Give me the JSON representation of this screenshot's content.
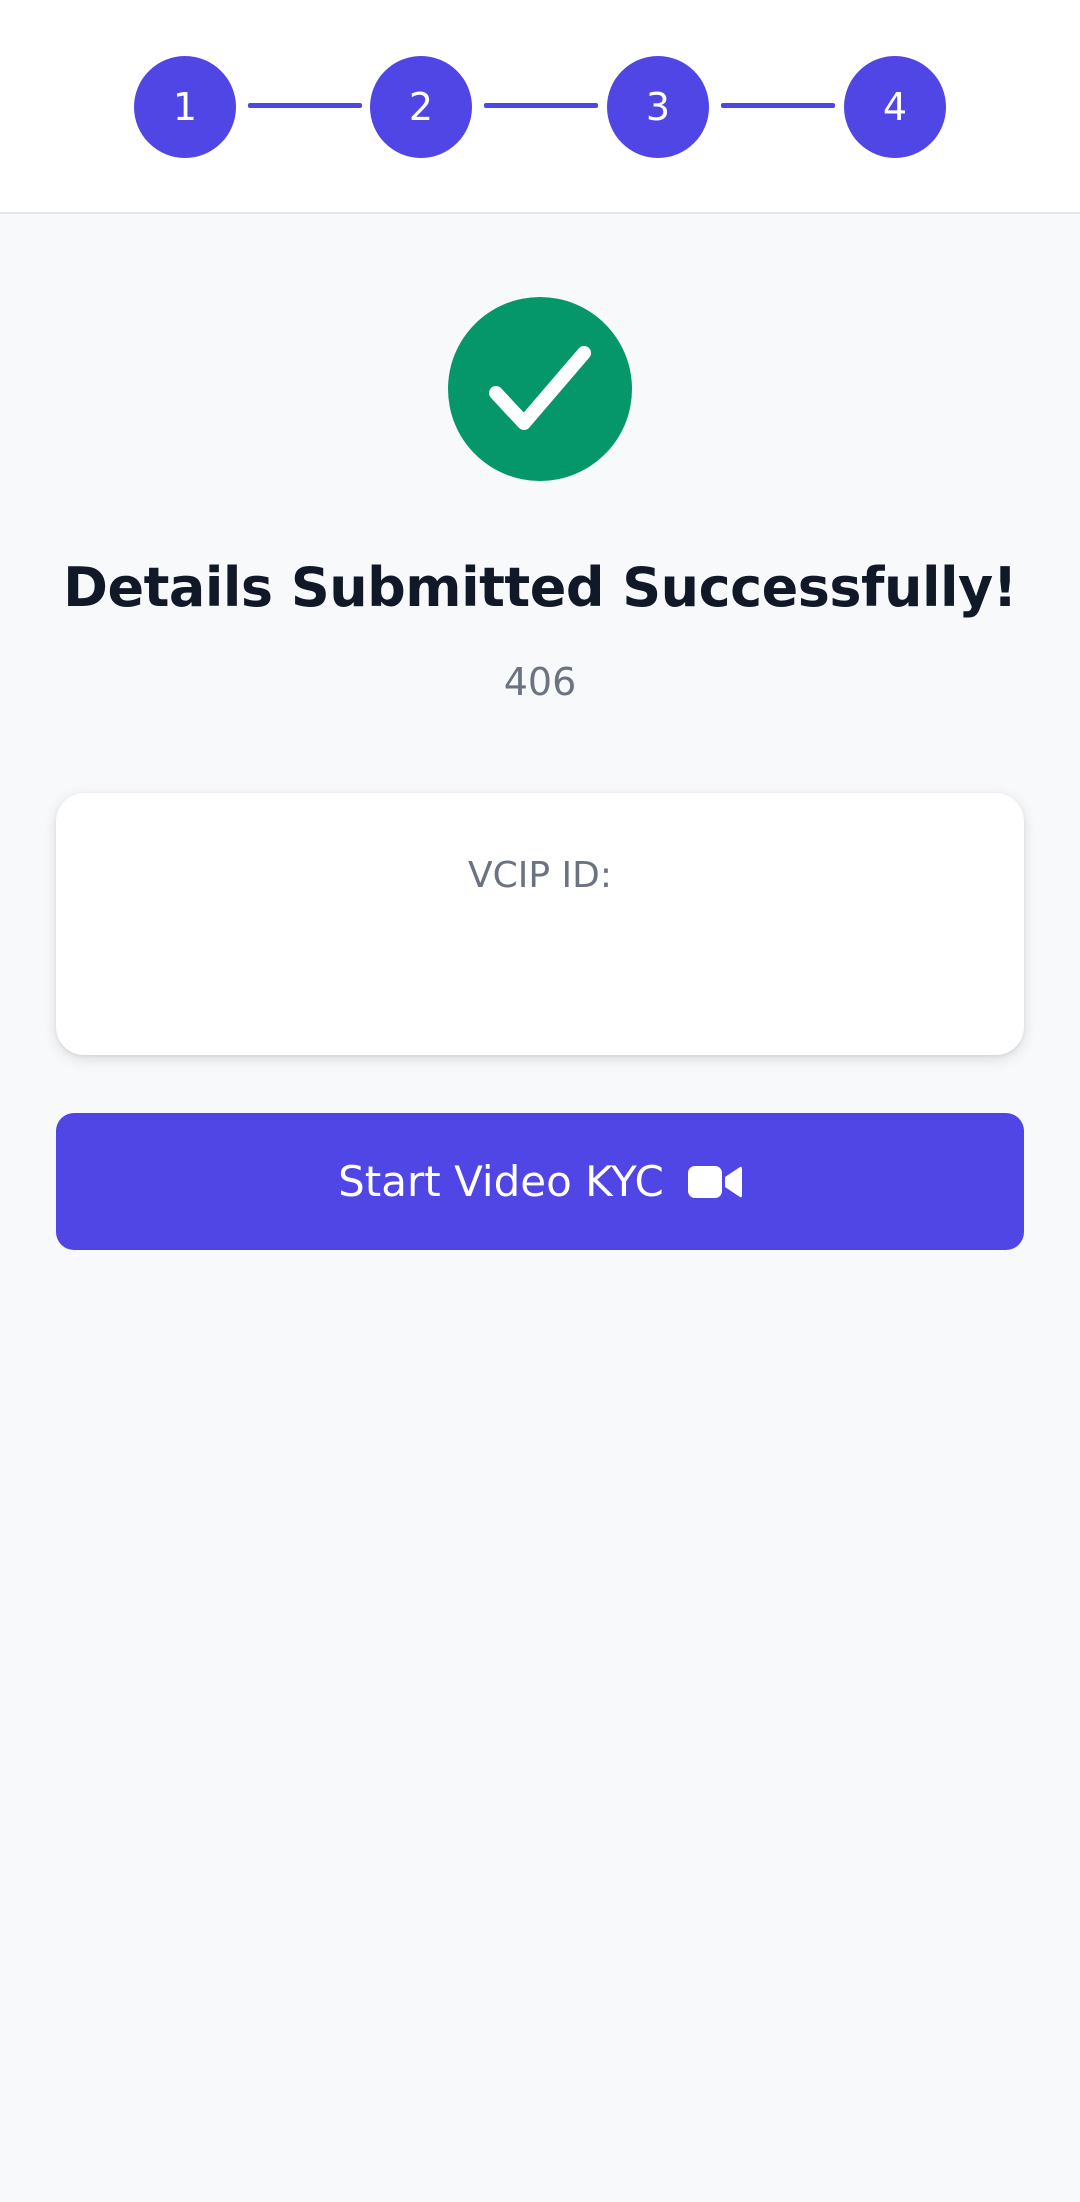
{
  "stepper": {
    "steps": [
      "1",
      "2",
      "3",
      "4"
    ]
  },
  "colors": {
    "accent": "#4f46e5",
    "success": "#059669",
    "background": "#f8f9fb"
  },
  "success": {
    "icon": "check-icon",
    "title": "Details Submitted Successfully!",
    "subtitle": "406"
  },
  "card": {
    "label": "VCIP ID:",
    "value": ""
  },
  "cta": {
    "label": "Start Video KYC",
    "icon": "video-camera-icon"
  }
}
